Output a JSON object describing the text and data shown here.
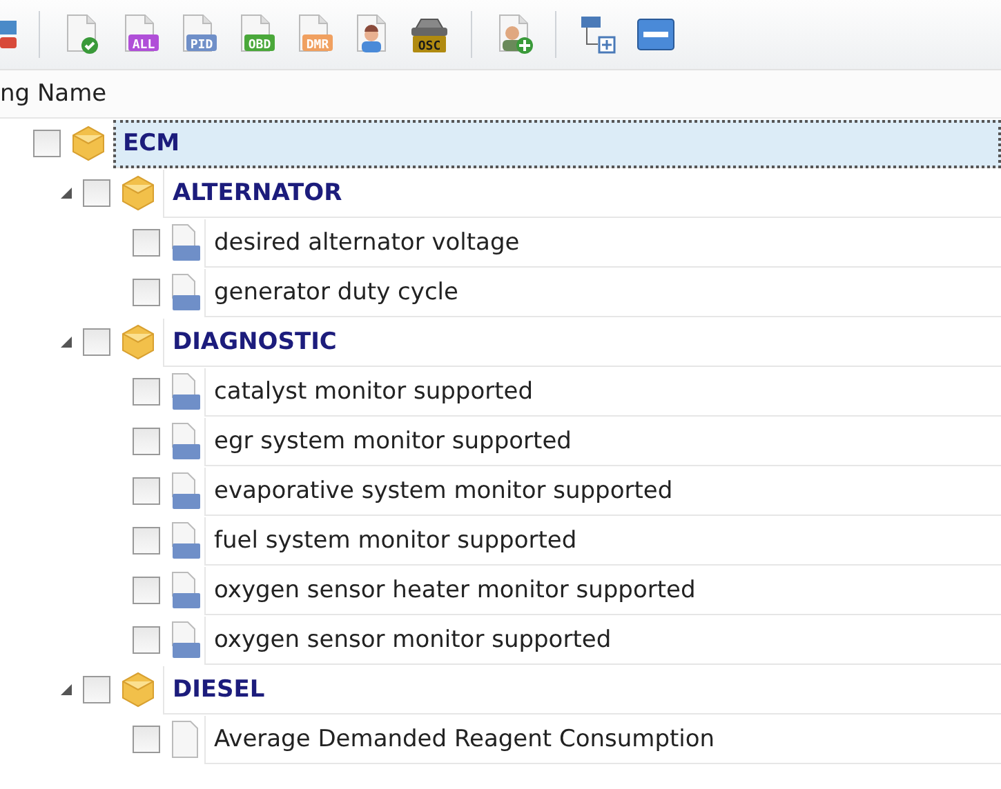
{
  "toolbar": [
    {
      "kind": "partial"
    },
    {
      "kind": "separator"
    },
    {
      "kind": "doc-check"
    },
    {
      "kind": "doc-tag",
      "label": "ALL",
      "color": "#b04fd8"
    },
    {
      "kind": "doc-tag",
      "label": "PID",
      "color": "#6f8fc8"
    },
    {
      "kind": "doc-tag",
      "label": "OBD",
      "color": "#4aa83a"
    },
    {
      "kind": "doc-tag",
      "label": "DMR",
      "color": "#f0a060"
    },
    {
      "kind": "doc-person"
    },
    {
      "kind": "car",
      "label": "OSC"
    },
    {
      "kind": "separator"
    },
    {
      "kind": "person-add"
    },
    {
      "kind": "separator"
    },
    {
      "kind": "tree-add"
    },
    {
      "kind": "minus-window"
    }
  ],
  "column_header": "ng Name",
  "tree": [
    {
      "kind": "module",
      "label": "ECM",
      "checked": false,
      "selected": true,
      "children": [
        {
          "kind": "group",
          "label": "ALTERNATOR",
          "checked": false,
          "selected": false,
          "expanded": true,
          "children": [
            {
              "kind": "pid",
              "label": "desired alternator voltage",
              "checked": false,
              "selected": false
            },
            {
              "kind": "pid",
              "label": "generator duty cycle",
              "checked": false,
              "selected": false
            }
          ]
        },
        {
          "kind": "group",
          "label": "DIAGNOSTIC",
          "checked": false,
          "selected": false,
          "expanded": true,
          "children": [
            {
              "kind": "pid",
              "label": "catalyst monitor supported",
              "checked": false,
              "selected": false
            },
            {
              "kind": "pid",
              "label": "egr system monitor supported",
              "checked": false,
              "selected": false
            },
            {
              "kind": "pid",
              "label": "evaporative system monitor supported",
              "checked": false,
              "selected": false
            },
            {
              "kind": "pid",
              "label": "fuel system monitor supported",
              "checked": false,
              "selected": false
            },
            {
              "kind": "pid",
              "label": "oxygen sensor heater monitor supported",
              "checked": false,
              "selected": false
            },
            {
              "kind": "pid",
              "label": "oxygen sensor monitor supported",
              "checked": false,
              "selected": false
            }
          ]
        },
        {
          "kind": "group",
          "label": "DIESEL",
          "checked": false,
          "selected": false,
          "expanded": true,
          "children": [
            {
              "kind": "doc",
              "label": "Average Demanded Reagent Consumption",
              "checked": false,
              "selected": false
            }
          ]
        }
      ]
    }
  ]
}
